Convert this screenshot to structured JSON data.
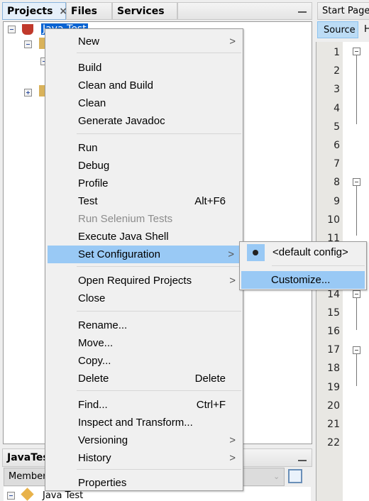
{
  "left_panel": {
    "tabs": [
      {
        "label": "Projects"
      },
      {
        "label": "Files"
      },
      {
        "label": "Services"
      }
    ],
    "close": "×",
    "minimize": "—"
  },
  "tree": {
    "root": "Java Test"
  },
  "editor": {
    "tabs": {
      "start_page": "Start Page",
      "source": "Source",
      "history": "H"
    },
    "line_numbers": [
      "1",
      "2",
      "3",
      "4",
      "5",
      "6",
      "7",
      "8",
      "9",
      "10",
      "11",
      "12",
      "13",
      "14",
      "15",
      "16",
      "17",
      "18",
      "19",
      "20",
      "21",
      "22"
    ]
  },
  "navigator": {
    "title": "JavaTest",
    "filter": "Members",
    "root": "Java Test"
  },
  "context_menu": {
    "items": [
      {
        "label": "New",
        "submenu": true
      },
      {
        "label": "Build"
      },
      {
        "label": "Clean and Build"
      },
      {
        "label": "Clean"
      },
      {
        "label": "Generate Javadoc"
      },
      {
        "label": "Run"
      },
      {
        "label": "Debug"
      },
      {
        "label": "Profile"
      },
      {
        "label": "Test",
        "shortcut": "Alt+F6"
      },
      {
        "label": "Run Selenium Tests",
        "disabled": true
      },
      {
        "label": "Execute Java Shell"
      },
      {
        "label": "Set Configuration",
        "submenu": true,
        "highlighted": true
      },
      {
        "label": "Open Required Projects",
        "submenu": true
      },
      {
        "label": "Close"
      },
      {
        "label": "Rename..."
      },
      {
        "label": "Move..."
      },
      {
        "label": "Copy..."
      },
      {
        "label": "Delete",
        "shortcut": "Delete"
      },
      {
        "label": "Find...",
        "shortcut": "Ctrl+F"
      },
      {
        "label": "Inspect and Transform..."
      },
      {
        "label": "Versioning",
        "submenu": true
      },
      {
        "label": "History",
        "submenu": true
      },
      {
        "label": "Properties"
      }
    ]
  },
  "submenu": {
    "items": [
      {
        "label": "<default config>",
        "selected": true
      },
      {
        "label": "Customize...",
        "highlighted": true
      }
    ]
  },
  "colors": {
    "highlight": "#99c9f5",
    "selection": "#0a64d2"
  }
}
